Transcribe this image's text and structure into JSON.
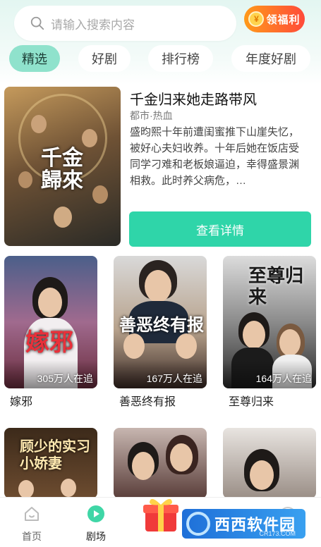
{
  "search": {
    "placeholder": "请输入搜索内容"
  },
  "welfare": {
    "label": "领福利"
  },
  "tabs": [
    {
      "label": "精选",
      "active": true
    },
    {
      "label": "好剧",
      "active": false
    },
    {
      "label": "排行榜",
      "active": false
    },
    {
      "label": "年度好剧",
      "active": false
    }
  ],
  "featured": {
    "poster_text": "千金歸來",
    "title": "千金归来她走路带风",
    "genre": "都市·热血",
    "description": "盛昀熙十年前遭闺蜜推下山崖失忆，被好心夫妇收养。十年后她在饭店受同学刁难和老板娘逼迫，幸得盛景渊相救。此时养父病危，…",
    "button": "查看详情"
  },
  "dramas": [
    {
      "title": "嫁邪",
      "followers": "305万人在追",
      "poster_text": "嫁邪"
    },
    {
      "title": "善恶终有报",
      "followers": "167万人在追",
      "poster_text": "善恶终有报"
    },
    {
      "title": "至尊归来",
      "followers": "164万人在追",
      "poster_text": "至尊归来"
    },
    {
      "title": "",
      "followers": "",
      "poster_text": "顾少的实习小娇妻"
    },
    {
      "title": "",
      "followers": "",
      "poster_text": ""
    },
    {
      "title": "",
      "followers": "",
      "poster_text": ""
    }
  ],
  "nav": [
    {
      "label": "首页",
      "icon": "home-icon",
      "active": false
    },
    {
      "label": "剧场",
      "icon": "play-icon",
      "active": true
    }
  ],
  "watermark": {
    "text": "西西软件园",
    "sub": "CR173.COM"
  },
  "colors": {
    "accent": "#2fd5a9",
    "tab_active": "#8fe2cc",
    "welfare": "#ff5a33"
  }
}
